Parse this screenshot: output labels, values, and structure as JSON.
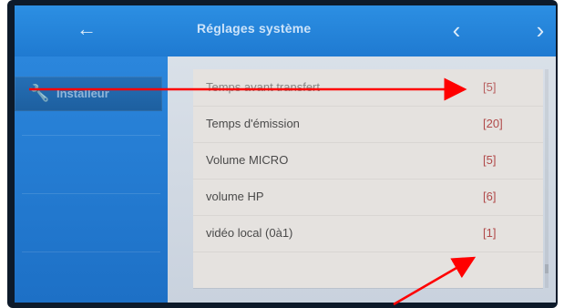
{
  "header": {
    "title": "Réglages système",
    "back_icon": "arrow-left-icon",
    "prev_icon": "chevron-left-icon",
    "next_icon": "chevron-right-icon"
  },
  "sidebar": {
    "items": [
      {
        "icon": "wrench-icon",
        "label": "Installeur"
      }
    ]
  },
  "settings": [
    {
      "label": "Temps avant transfert",
      "value": "[5]"
    },
    {
      "label": "Temps d'émission",
      "value": "[20]"
    },
    {
      "label": "Volume MICRO",
      "value": "[5]"
    },
    {
      "label": "volume HP",
      "value": "[6]"
    },
    {
      "label": "vidéo local (0à1)",
      "value": "[1]"
    }
  ],
  "colors": {
    "header_blue": "#1f7ad1",
    "sidebar_blue": "#1d70c6",
    "value_red": "#b14a4a",
    "annotation_red": "#ff0000"
  }
}
